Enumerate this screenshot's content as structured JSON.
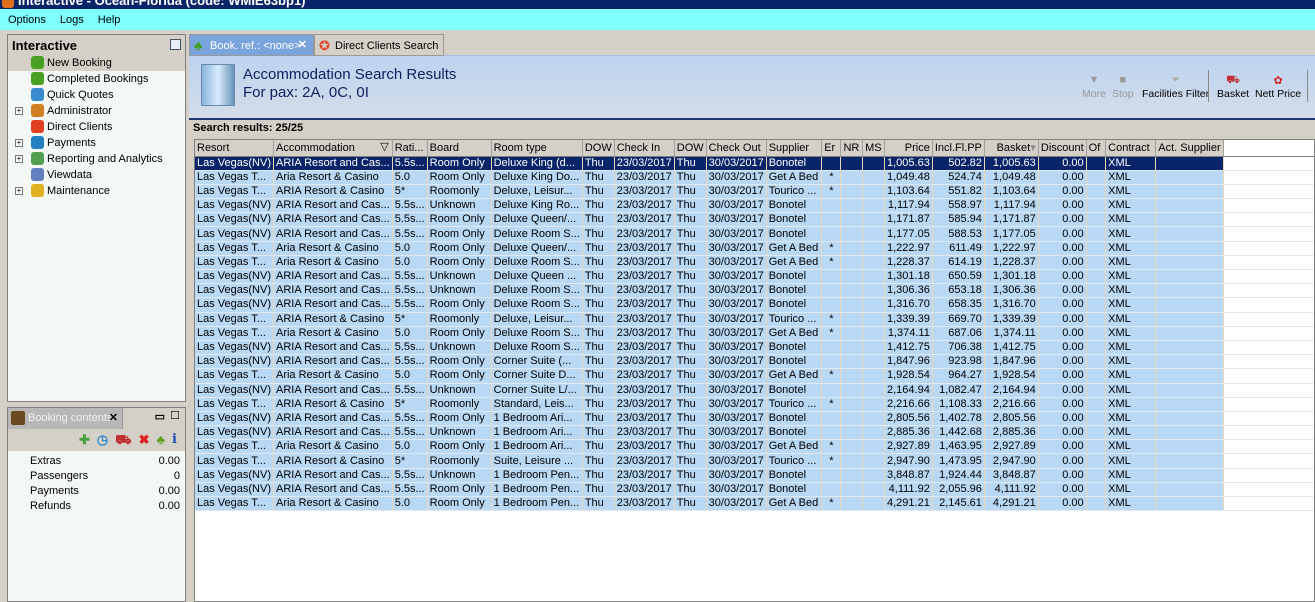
{
  "window": {
    "title": "Interactive - Ocean-Florida (code: WMIE63bp1)"
  },
  "menu": [
    "Options",
    "Logs",
    "Help"
  ],
  "nav": {
    "title": "Interactive",
    "items": [
      {
        "label": "New Booking",
        "expandable": false,
        "icon": "palm-tree-icon",
        "color": "#48a020"
      },
      {
        "label": "Completed Bookings",
        "expandable": false,
        "icon": "palm-tree-ticket-icon",
        "color": "#48a020"
      },
      {
        "label": "Quick Quotes",
        "expandable": false,
        "icon": "clock-icon",
        "color": "#3a8ad0"
      },
      {
        "label": "Administrator",
        "expandable": true,
        "icon": "running-man-icon",
        "color": "#d08020"
      },
      {
        "label": "Direct Clients",
        "expandable": false,
        "icon": "client-icon",
        "color": "#e04020"
      },
      {
        "label": "Payments",
        "expandable": true,
        "icon": "payment-icon",
        "color": "#2080c0"
      },
      {
        "label": "Reporting and Analytics",
        "expandable": true,
        "icon": "report-icon",
        "color": "#50a050"
      },
      {
        "label": "Viewdata",
        "expandable": false,
        "icon": "viewdata-icon",
        "color": "#6080c0"
      },
      {
        "label": "Maintenance",
        "expandable": true,
        "icon": "toolbox-icon",
        "color": "#e0b020"
      }
    ]
  },
  "booking_contents": {
    "tab": "Booking contents",
    "rows": [
      {
        "label": "Extras",
        "value": "0.00"
      },
      {
        "label": "Passengers",
        "value": "0"
      },
      {
        "label": "Payments",
        "value": "0.00"
      },
      {
        "label": "Refunds",
        "value": "0.00"
      }
    ]
  },
  "tabs": [
    {
      "label": "Book. ref.: <none>"
    },
    {
      "label": "Direct Clients Search"
    }
  ],
  "header": {
    "title": "Accommodation Search Results",
    "subtitle": "For pax: 2A, 0C, 0I"
  },
  "toolbar": {
    "more": "More",
    "stop": "Stop",
    "facilities": "Facilities Filter",
    "basket": "Basket",
    "nett": "Nett Price"
  },
  "results_label": "Search results: 25/25",
  "columns": [
    "Resort",
    "Accommodation",
    "Rati...",
    "Board",
    "Room type",
    "DOW",
    "Check In",
    "DOW",
    "Check Out",
    "Supplier",
    "Er",
    "NR",
    "MS",
    "Price",
    "Incl.Fl.PP",
    "Basket",
    "Discount",
    "Of",
    "Contract",
    "Act. Supplier"
  ],
  "rows": [
    [
      "Las Vegas(NV)",
      "ARIA Resort and Cas...",
      "5.5s...",
      "Room Only",
      "Deluxe King (d...",
      "Thu",
      "23/03/2017",
      "Thu",
      "30/03/2017",
      "Bonotel",
      "",
      "",
      "",
      "1,005.63",
      "502.82",
      "1,005.63",
      "0.00",
      "",
      "XML",
      ""
    ],
    [
      "Las Vegas T...",
      "Aria Resort & Casino",
      "5.0",
      "Room Only",
      "Deluxe King Do...",
      "Thu",
      "23/03/2017",
      "Thu",
      "30/03/2017",
      "Get A Bed",
      "*",
      "",
      "",
      "1,049.48",
      "524.74",
      "1,049.48",
      "0.00",
      "",
      "XML",
      ""
    ],
    [
      "Las Vegas T...",
      "ARIA Resort & Casino",
      "5*",
      "Roomonly",
      "Deluxe, Leisur...",
      "Thu",
      "23/03/2017",
      "Thu",
      "30/03/2017",
      "Tourico ...",
      "*",
      "",
      "",
      "1,103.64",
      "551.82",
      "1,103.64",
      "0.00",
      "",
      "XML",
      ""
    ],
    [
      "Las Vegas(NV)",
      "ARIA Resort and Cas...",
      "5.5s...",
      "Unknown",
      "Deluxe King Ro...",
      "Thu",
      "23/03/2017",
      "Thu",
      "30/03/2017",
      "Bonotel",
      "",
      "",
      "",
      "1,117.94",
      "558.97",
      "1,117.94",
      "0.00",
      "",
      "XML",
      ""
    ],
    [
      "Las Vegas(NV)",
      "ARIA Resort and Cas...",
      "5.5s...",
      "Room Only",
      "Deluxe Queen/...",
      "Thu",
      "23/03/2017",
      "Thu",
      "30/03/2017",
      "Bonotel",
      "",
      "",
      "",
      "1,171.87",
      "585.94",
      "1,171.87",
      "0.00",
      "",
      "XML",
      ""
    ],
    [
      "Las Vegas(NV)",
      "ARIA Resort and Cas...",
      "5.5s...",
      "Room Only",
      "Deluxe Room S...",
      "Thu",
      "23/03/2017",
      "Thu",
      "30/03/2017",
      "Bonotel",
      "",
      "",
      "",
      "1,177.05",
      "588.53",
      "1,177.05",
      "0.00",
      "",
      "XML",
      ""
    ],
    [
      "Las Vegas T...",
      "Aria Resort & Casino",
      "5.0",
      "Room Only",
      "Deluxe Queen/...",
      "Thu",
      "23/03/2017",
      "Thu",
      "30/03/2017",
      "Get A Bed",
      "*",
      "",
      "",
      "1,222.97",
      "611.49",
      "1,222.97",
      "0.00",
      "",
      "XML",
      ""
    ],
    [
      "Las Vegas T...",
      "Aria Resort & Casino",
      "5.0",
      "Room Only",
      "Deluxe Room S...",
      "Thu",
      "23/03/2017",
      "Thu",
      "30/03/2017",
      "Get A Bed",
      "*",
      "",
      "",
      "1,228.37",
      "614.19",
      "1,228.37",
      "0.00",
      "",
      "XML",
      ""
    ],
    [
      "Las Vegas(NV)",
      "ARIA Resort and Cas...",
      "5.5s...",
      "Unknown",
      "Deluxe Queen ...",
      "Thu",
      "23/03/2017",
      "Thu",
      "30/03/2017",
      "Bonotel",
      "",
      "",
      "",
      "1,301.18",
      "650.59",
      "1,301.18",
      "0.00",
      "",
      "XML",
      ""
    ],
    [
      "Las Vegas(NV)",
      "ARIA Resort and Cas...",
      "5.5s...",
      "Unknown",
      "Deluxe Room S...",
      "Thu",
      "23/03/2017",
      "Thu",
      "30/03/2017",
      "Bonotel",
      "",
      "",
      "",
      "1,306.36",
      "653.18",
      "1,306.36",
      "0.00",
      "",
      "XML",
      ""
    ],
    [
      "Las Vegas(NV)",
      "ARIA Resort and Cas...",
      "5.5s...",
      "Room Only",
      "Deluxe Room S...",
      "Thu",
      "23/03/2017",
      "Thu",
      "30/03/2017",
      "Bonotel",
      "",
      "",
      "",
      "1,316.70",
      "658.35",
      "1,316.70",
      "0.00",
      "",
      "XML",
      ""
    ],
    [
      "Las Vegas T...",
      "ARIA Resort & Casino",
      "5*",
      "Roomonly",
      "Deluxe, Leisur...",
      "Thu",
      "23/03/2017",
      "Thu",
      "30/03/2017",
      "Tourico ...",
      "*",
      "",
      "",
      "1,339.39",
      "669.70",
      "1,339.39",
      "0.00",
      "",
      "XML",
      ""
    ],
    [
      "Las Vegas T...",
      "Aria Resort & Casino",
      "5.0",
      "Room Only",
      "Deluxe Room S...",
      "Thu",
      "23/03/2017",
      "Thu",
      "30/03/2017",
      "Get A Bed",
      "*",
      "",
      "",
      "1,374.11",
      "687.06",
      "1,374.11",
      "0.00",
      "",
      "XML",
      ""
    ],
    [
      "Las Vegas(NV)",
      "ARIA Resort and Cas...",
      "5.5s...",
      "Unknown",
      "Deluxe Room S...",
      "Thu",
      "23/03/2017",
      "Thu",
      "30/03/2017",
      "Bonotel",
      "",
      "",
      "",
      "1,412.75",
      "706.38",
      "1,412.75",
      "0.00",
      "",
      "XML",
      ""
    ],
    [
      "Las Vegas(NV)",
      "ARIA Resort and Cas...",
      "5.5s...",
      "Room Only",
      "Corner Suite (...",
      "Thu",
      "23/03/2017",
      "Thu",
      "30/03/2017",
      "Bonotel",
      "",
      "",
      "",
      "1,847.96",
      "923.98",
      "1,847.96",
      "0.00",
      "",
      "XML",
      ""
    ],
    [
      "Las Vegas T...",
      "Aria Resort & Casino",
      "5.0",
      "Room Only",
      "Corner Suite D...",
      "Thu",
      "23/03/2017",
      "Thu",
      "30/03/2017",
      "Get A Bed",
      "*",
      "",
      "",
      "1,928.54",
      "964.27",
      "1,928.54",
      "0.00",
      "",
      "XML",
      ""
    ],
    [
      "Las Vegas(NV)",
      "ARIA Resort and Cas...",
      "5.5s...",
      "Unknown",
      "Corner Suite L/...",
      "Thu",
      "23/03/2017",
      "Thu",
      "30/03/2017",
      "Bonotel",
      "",
      "",
      "",
      "2,164.94",
      "1,082.47",
      "2,164.94",
      "0.00",
      "",
      "XML",
      ""
    ],
    [
      "Las Vegas T...",
      "ARIA Resort & Casino",
      "5*",
      "Roomonly",
      "Standard, Leis...",
      "Thu",
      "23/03/2017",
      "Thu",
      "30/03/2017",
      "Tourico ...",
      "*",
      "",
      "",
      "2,216.66",
      "1,108.33",
      "2,216.66",
      "0.00",
      "",
      "XML",
      ""
    ],
    [
      "Las Vegas(NV)",
      "ARIA Resort and Cas...",
      "5.5s...",
      "Room Only",
      "1 Bedroom Ari...",
      "Thu",
      "23/03/2017",
      "Thu",
      "30/03/2017",
      "Bonotel",
      "",
      "",
      "",
      "2,805.56",
      "1,402.78",
      "2,805.56",
      "0.00",
      "",
      "XML",
      ""
    ],
    [
      "Las Vegas(NV)",
      "ARIA Resort and Cas...",
      "5.5s...",
      "Unknown",
      "1 Bedroom Ari...",
      "Thu",
      "23/03/2017",
      "Thu",
      "30/03/2017",
      "Bonotel",
      "",
      "",
      "",
      "2,885.36",
      "1,442.68",
      "2,885.36",
      "0.00",
      "",
      "XML",
      ""
    ],
    [
      "Las Vegas T...",
      "Aria Resort & Casino",
      "5.0",
      "Room Only",
      "1 Bedroom Ari...",
      "Thu",
      "23/03/2017",
      "Thu",
      "30/03/2017",
      "Get A Bed",
      "*",
      "",
      "",
      "2,927.89",
      "1,463.95",
      "2,927.89",
      "0.00",
      "",
      "XML",
      ""
    ],
    [
      "Las Vegas T...",
      "ARIA Resort & Casino",
      "5*",
      "Roomonly",
      "Suite, Leisure ...",
      "Thu",
      "23/03/2017",
      "Thu",
      "30/03/2017",
      "Tourico ...",
      "*",
      "",
      "",
      "2,947.90",
      "1,473.95",
      "2,947.90",
      "0.00",
      "",
      "XML",
      ""
    ],
    [
      "Las Vegas(NV)",
      "ARIA Resort and Cas...",
      "5.5s...",
      "Unknown",
      "1 Bedroom Pen...",
      "Thu",
      "23/03/2017",
      "Thu",
      "30/03/2017",
      "Bonotel",
      "",
      "",
      "",
      "3,848.87",
      "1,924.44",
      "3,848.87",
      "0.00",
      "",
      "XML",
      ""
    ],
    [
      "Las Vegas(NV)",
      "ARIA Resort and Cas...",
      "5.5s...",
      "Room Only",
      "1 Bedroom Pen...",
      "Thu",
      "23/03/2017",
      "Thu",
      "30/03/2017",
      "Bonotel",
      "",
      "",
      "",
      "4,111.92",
      "2,055.96",
      "4,111.92",
      "0.00",
      "",
      "XML",
      ""
    ],
    [
      "Las Vegas T...",
      "Aria Resort & Casino",
      "5.0",
      "Room Only",
      "1 Bedroom Pen...",
      "Thu",
      "23/03/2017",
      "Thu",
      "30/03/2017",
      "Get A Bed",
      "*",
      "",
      "",
      "4,291.21",
      "2,145.61",
      "4,291.21",
      "0.00",
      "",
      "XML",
      ""
    ]
  ]
}
